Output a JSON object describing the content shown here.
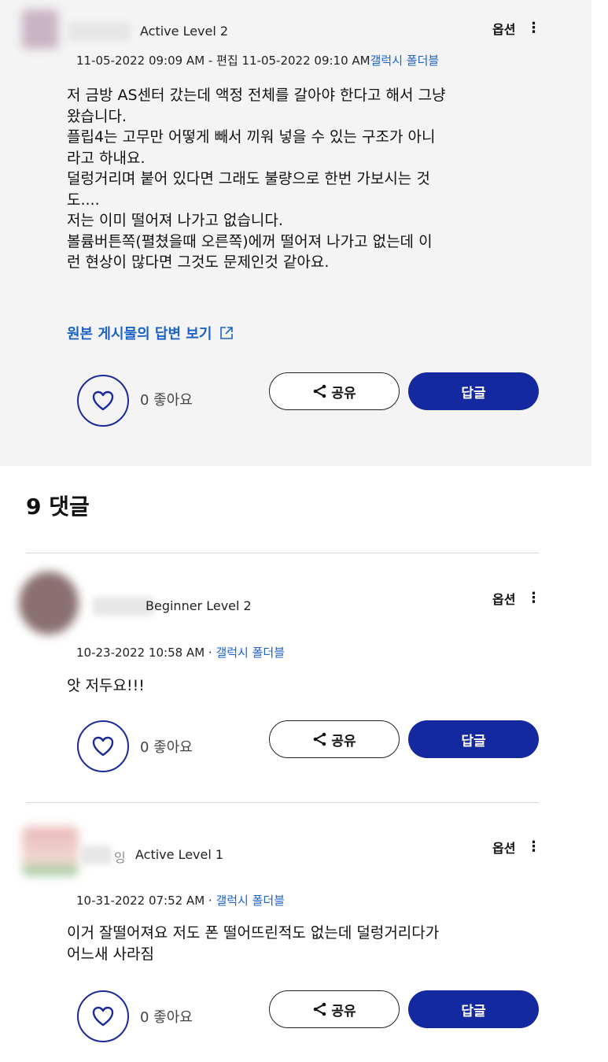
{
  "colors": {
    "accent": "#1b62c9",
    "brand_blue": "#1428a0",
    "post_bg": "#f4f4f4"
  },
  "icons": {
    "heart": "heart-icon",
    "share": "share-icon",
    "kebab": "kebab-menu-icon",
    "external": "external-link-icon"
  },
  "post": {
    "level": "Active Level 2",
    "options_label": "옵션",
    "kebab": "⋮",
    "timestamp": "11-05-2022 09:09 AM - 편집 11-05-2022 09:10 AM",
    "category": "갤럭시 폴더블",
    "body_lines": [
      "저 금방 AS센터 갔는데 액정 전체를 갈아야 한다고 해서 그냥",
      "왔습니다.",
      "플립4는 고무만 어떻게 빼서 끼워 넣을 수 있는 구조가 아니",
      "라고 하내요.",
      "덜렁거리며 붙어 있다면 그래도 불량으로 한번 가보시는 것",
      "도....",
      "저는 이미 떨어져 나가고 없습니다.",
      "볼륨버튼쪽(펼쳤을때 오른쪽)에꺼 떨어져 나가고 없는데 이",
      "런 현상이 많다면 그것도 문제인것 같아요."
    ],
    "view_original_label": "원본 게시물의 답변 보기",
    "likes_label": "0 좋아요",
    "share_label": "공유",
    "reply_label": "답글"
  },
  "comments_header": "9 댓글",
  "comments": [
    {
      "level": "Beginner Level 2",
      "options_label": "옵션",
      "kebab": "⋮",
      "timestamp": "10-23-2022 10:58 AM",
      "separator": " · ",
      "category": "갤럭시 폴더블",
      "body_lines": [
        "앗 저두요!!!"
      ],
      "likes_label": "0 좋아요",
      "share_label": "공유",
      "reply_label": "답글"
    },
    {
      "name_suffix": "잉",
      "level": "Active Level 1",
      "options_label": "옵션",
      "kebab": "⋮",
      "timestamp": "10-31-2022 07:52 AM",
      "separator": " · ",
      "category": "갤럭시 폴더블",
      "body_lines": [
        "이거 잘떨어져요 저도 폰 떨어뜨린적도 없는데 덜렁거리다가",
        "어느새 사라짐"
      ],
      "likes_label": "0 좋아요",
      "share_label": "공유",
      "reply_label": "답글"
    }
  ]
}
